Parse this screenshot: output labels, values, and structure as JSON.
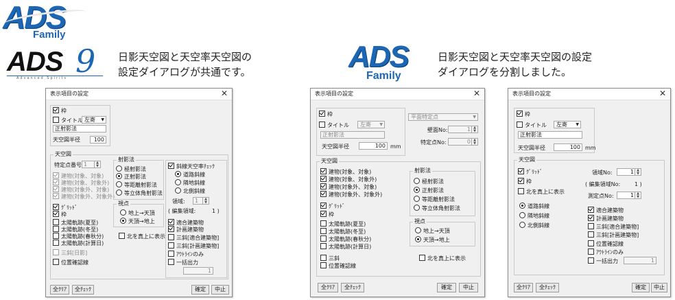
{
  "logos": {
    "ads_family_1": {
      "main": "ADS",
      "sub": "Family"
    },
    "ads9": {
      "main": "ADS",
      "num": "9",
      "tagline": "Advanced Spirits"
    },
    "ads_family_2": {
      "main": "ADS",
      "sub": "Family"
    }
  },
  "captions": {
    "left": [
      "日影天空図と天空率天空図の",
      "設定ダイアログが共通です。"
    ],
    "right": [
      "日影天空図と天空率天空図の設定",
      "ダイアログを分割しました。"
    ]
  },
  "dialog1": {
    "title": "表示項目の設定",
    "close": "✕",
    "waku": "枠",
    "title_cb": "タイトル",
    "title_align": "左寄",
    "title_text": "正射影法",
    "radius_label": "天空図半径",
    "radius_value": "100",
    "tenkuzu": "天空図",
    "point_label": "特定点番号:",
    "point_value": "1",
    "bld_items": [
      "建物(対象、対象)",
      "建物(対象、対象外)",
      "建物(対象外、対象)",
      "建物(対象外、対象外)"
    ],
    "grid": "ｸﾞﾘｯﾄﾞ",
    "waku2": "枠",
    "sun_items": [
      "太陽軌跡(夏至)",
      "太陽軌跡(冬至)",
      "太陽軌跡(春秋分)",
      "太陽軌跡(計算日)"
    ],
    "sanryo": "三斜[日影]",
    "position": "位置確認線",
    "proj_group": "射影法",
    "proj_items": [
      "極射影法",
      "正射影法",
      "等距離射影法",
      "等立体角射影法"
    ],
    "view_group": "視点",
    "view_items": [
      "地上→天頂",
      "天頂→地上"
    ],
    "north": "北を真上に表示",
    "slope": "斜線天空率ﾁｪｯｸ",
    "slope_items": [
      "道路斜線",
      "隣地斜線",
      "北側斜線"
    ],
    "area_label": "領域:",
    "area_value": "1",
    "edit_area": "( 編集領域:",
    "edit_area_value": "1 )",
    "bldg_items": [
      "適合建築物",
      "計画建築物",
      "三斜[適合建築物]",
      "三斜[計画建築物]"
    ],
    "outline": "ｱｳﾄﾗｲﾝのみ",
    "batch": "一括出力",
    "batch_value": "1",
    "clear": "全ｸﾘｱ",
    "check": "全ﾁｪｯｸ",
    "ok": "確定",
    "cancel": "中止"
  },
  "dialog2": {
    "title": "表示項目の設定",
    "close": "✕",
    "waku": "枠",
    "title_cb": "タイトル",
    "title_align": "左寄",
    "title_text": "正射影法",
    "radius_label": "天空図半径",
    "radius_value": "100",
    "unit": "mm",
    "plane": "平面特定点",
    "wall_label": "壁面No:",
    "wall_value": "1",
    "point_label": "特定点No:",
    "point_value": "0",
    "tenkuzu": "天空図",
    "bld_items": [
      "建物(対象、対象)",
      "建物(対象、対象外)",
      "建物(対象外、対象)",
      "建物(対象外、対象外)"
    ],
    "grid": "ｸﾞﾘｯﾄﾞ",
    "waku2": "枠",
    "sun_items": [
      "太陽軌跡(夏至)",
      "太陽軌跡(冬至)",
      "太陽軌跡(春秋分)",
      "太陽軌跡(計算日)"
    ],
    "sanryo": "三斜",
    "position": "位置確認線",
    "proj_group": "射影法",
    "proj_items": [
      "極射影法",
      "正射影法",
      "等距離射影法",
      "等立体角射影法"
    ],
    "view_group": "視点",
    "view_items": [
      "地上→天頂",
      "天頂→地上"
    ],
    "north": "北を真上に表示",
    "clear": "全ｸﾘｱ",
    "check": "全ﾁｪｯｸ",
    "ok": "確定",
    "cancel": "中止"
  },
  "dialog3": {
    "title": "表示項目の設定",
    "close": "✕",
    "waku": "枠",
    "title_cb": "タイトル",
    "title_align": "左寄",
    "title_text": "正射影法",
    "radius_label": "天空図半径",
    "radius_value": "100",
    "unit": "mm",
    "tenkuzu": "天空図",
    "grid": "ｸﾞﾘｯﾄﾞ",
    "waku2": "枠",
    "north": "北を真上に表示",
    "area_label": "領域No:",
    "area_value": "1",
    "edit_area": "( 編集領域No:",
    "edit_area_value": "1 )",
    "meas_label": "測定点No:",
    "meas_value": "1",
    "slope_items": [
      "道路斜線",
      "隣地斜線",
      "北側斜線"
    ],
    "bldg_items": [
      "適合建築物",
      "計画建築物",
      "三斜[適合建築物]",
      "三斜[計画建築物]"
    ],
    "position": "位置確認線",
    "outline": "ｱｳﾄﾗｲﾝのみ",
    "batch": "一括出力",
    "batch_value": "1",
    "clear": "全ｸﾘｱ",
    "check": "全ﾁｪｯｸ",
    "ok": "確定",
    "cancel": "中止"
  }
}
